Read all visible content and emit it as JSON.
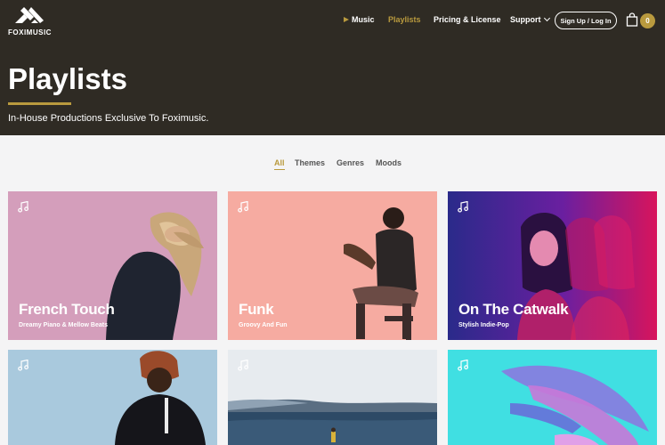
{
  "brand": {
    "name": "FOXIMUSIC"
  },
  "nav": {
    "items": [
      {
        "label": "Music"
      },
      {
        "label": "Playlists"
      },
      {
        "label": "Pricing & License"
      },
      {
        "label": "Support"
      }
    ],
    "signup_label": "Sign Up / Log In",
    "cart_count": "0"
  },
  "hero": {
    "title": "Playlists",
    "subtitle": "In-House Productions Exclusive To Foximusic."
  },
  "filters": [
    {
      "label": "All"
    },
    {
      "label": "Themes"
    },
    {
      "label": "Genres"
    },
    {
      "label": "Moods"
    }
  ],
  "playlists": [
    {
      "title": "French Touch",
      "subtitle": "Dreamy Piano & Mellow Beats"
    },
    {
      "title": "Funk",
      "subtitle": "Groovy And Fun"
    },
    {
      "title": "On The Catwalk",
      "subtitle": "Stylish Indie-Pop"
    },
    {
      "title": "",
      "subtitle": ""
    },
    {
      "title": "",
      "subtitle": ""
    },
    {
      "title": "",
      "subtitle": ""
    }
  ],
  "colors": {
    "header_bg": "#2f2b24",
    "accent": "#b99a3e",
    "page_bg": "#f4f4f5"
  },
  "icons": [
    "logo-mark-icon",
    "play-icon",
    "chevron-down-icon",
    "cart-icon",
    "music-note-icon"
  ]
}
